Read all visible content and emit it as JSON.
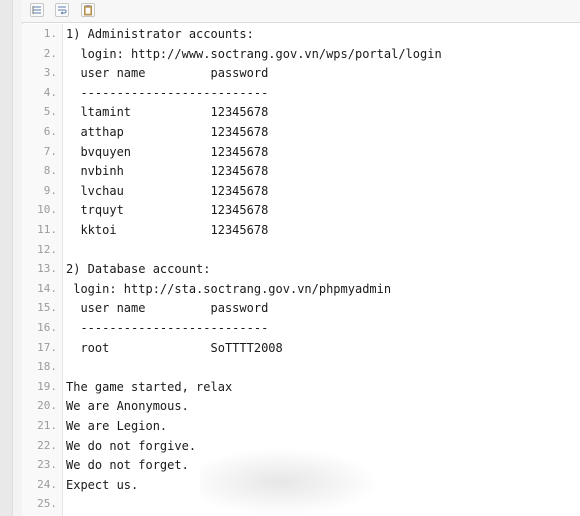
{
  "toolbar": {
    "buttons": [
      {
        "icon": "view-source-icon"
      },
      {
        "icon": "wrap-text-icon"
      },
      {
        "icon": "copy-clipboard-icon"
      }
    ]
  },
  "lines": [
    {
      "n": "1.",
      "text": "1) Administrator accounts:"
    },
    {
      "n": "2.",
      "text": "  login: http://www.soctrang.gov.vn/wps/portal/login"
    },
    {
      "n": "3.",
      "text": "  user name         password"
    },
    {
      "n": "4.",
      "text": "  --------------------------"
    },
    {
      "n": "5.",
      "text": "  ltamint           12345678"
    },
    {
      "n": "6.",
      "text": "  atthap            12345678"
    },
    {
      "n": "7.",
      "text": "  bvquyen           12345678"
    },
    {
      "n": "8.",
      "text": "  nvbinh            12345678"
    },
    {
      "n": "9.",
      "text": "  lvchau            12345678"
    },
    {
      "n": "10.",
      "text": "  trquyt            12345678"
    },
    {
      "n": "11.",
      "text": "  kktoi             12345678"
    },
    {
      "n": "12.",
      "text": ""
    },
    {
      "n": "13.",
      "text": "2) Database account:"
    },
    {
      "n": "14.",
      "text": " login: http://sta.soctrang.gov.vn/phpmyadmin"
    },
    {
      "n": "15.",
      "text": "  user name         password"
    },
    {
      "n": "16.",
      "text": "  --------------------------"
    },
    {
      "n": "17.",
      "text": "  root              SoTTTT2008"
    },
    {
      "n": "18.",
      "text": ""
    },
    {
      "n": "19.",
      "text": "The game started, relax"
    },
    {
      "n": "20.",
      "text": "We are Anonymous."
    },
    {
      "n": "21.",
      "text": "We are Legion."
    },
    {
      "n": "22.",
      "text": "We do not forgive."
    },
    {
      "n": "23.",
      "text": "We do not forget."
    },
    {
      "n": "24.",
      "text": "Expect us."
    },
    {
      "n": "25.",
      "text": ""
    }
  ]
}
